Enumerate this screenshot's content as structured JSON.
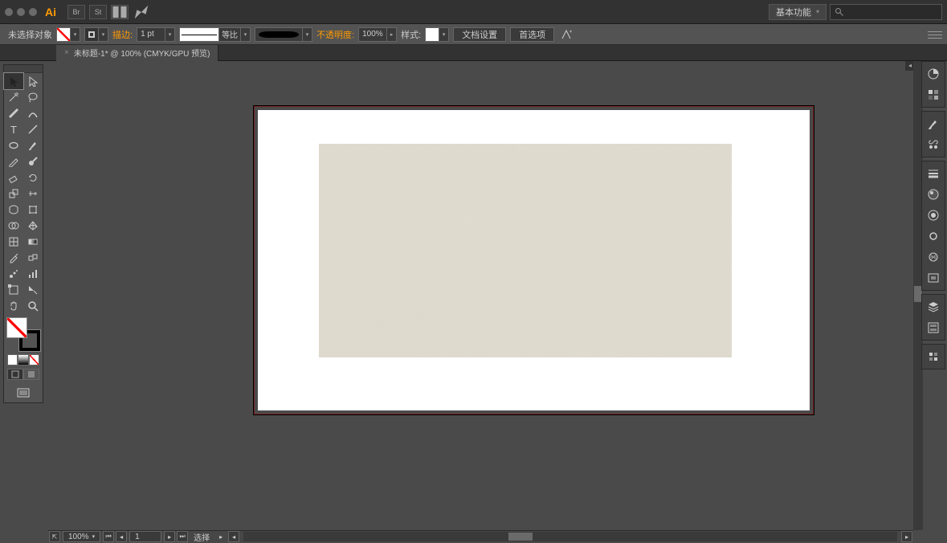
{
  "titlebar": {
    "app": "Ai",
    "workspace_label": "基本功能",
    "search_placeholder": ""
  },
  "controlbar": {
    "no_selection": "未选择对象",
    "stroke_label": "描边:",
    "stroke_weight": "1 pt",
    "stroke_align": "等比",
    "opacity_label": "不透明度:",
    "opacity_value": "100%",
    "style_label": "样式:",
    "doc_setup": "文档设置",
    "prefs": "首选项"
  },
  "document": {
    "tab_label": "未标题-1* @ 100% (CMYK/GPU 预览)"
  },
  "statusbar": {
    "zoom": "100%",
    "artboard_num": "1",
    "select_label": "选择"
  },
  "tools": [
    [
      "selection",
      "direct-selection"
    ],
    [
      "magic-wand",
      "lasso"
    ],
    [
      "pen",
      "curvature"
    ],
    [
      "type",
      "line"
    ],
    [
      "ellipse",
      "brush"
    ],
    [
      "pencil",
      "blob"
    ],
    [
      "eraser",
      "rotate"
    ],
    [
      "scale",
      "width"
    ],
    [
      "warp",
      "free-transform"
    ],
    [
      "shape-builder",
      "perspective"
    ],
    [
      "mesh",
      "gradient"
    ],
    [
      "eyedropper",
      "blend"
    ],
    [
      "symbol-spray",
      "graph"
    ],
    [
      "artboard",
      "slice"
    ],
    [
      "hand",
      "zoom"
    ]
  ],
  "dock_groups": [
    [
      "color",
      "swatches"
    ],
    [
      "brushes",
      "symbols"
    ],
    [
      "stroke-panel",
      "appearance",
      "graphic-styles",
      "cc-libraries",
      "transparency-panel",
      "align"
    ],
    [
      "layers",
      "assets"
    ],
    [
      "actions"
    ]
  ]
}
